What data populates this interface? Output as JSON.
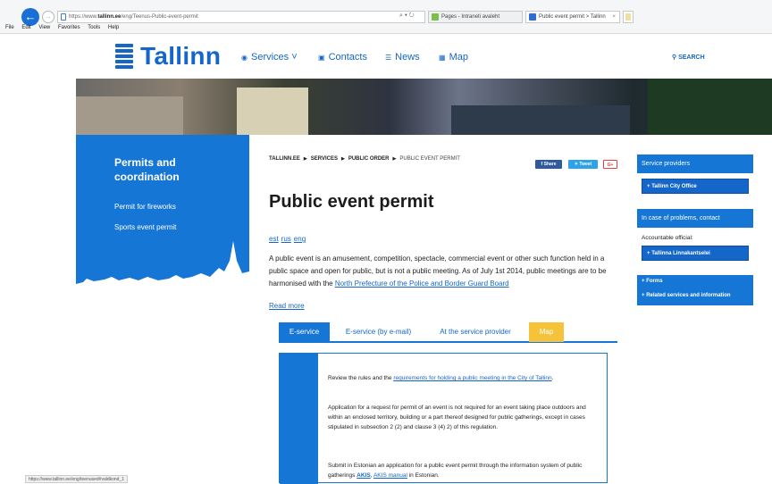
{
  "browser": {
    "url_prefix": "https://www.",
    "url_domain": "tallinn.ee",
    "url_path": "/eng/Teenus-Public-event-permit",
    "address_icons": "⌕ ▾ ↻",
    "tabs": [
      {
        "label": "Pages - Intraneti avaleht"
      },
      {
        "label": "Public event permit > Tallinn"
      }
    ],
    "tab_close": "×",
    "menu": [
      "File",
      "Edit",
      "View",
      "Favorites",
      "Tools",
      "Help"
    ],
    "status_url": "https://www.tallinn.ee/eng/teenused#valdkond_1"
  },
  "header": {
    "logo_text": "Tallinn",
    "nav": {
      "services": "Services",
      "services_caret": "˅",
      "contacts": "Contacts",
      "news": "News",
      "map": "Map"
    },
    "search_label": "SEARCH"
  },
  "leftbar": {
    "title": "Permits and coordination",
    "links": [
      "Permit for fireworks",
      "Sports event permit"
    ]
  },
  "breadcrumb": [
    "TALLINN.EE",
    "SERVICES",
    "PUBLIC ORDER",
    "PUBLIC EVENT PERMIT"
  ],
  "share": {
    "facebook": "Share",
    "twitter": "Tweet",
    "gplus": "G+"
  },
  "article": {
    "title": "Public event permit",
    "languages": [
      "est",
      "rus",
      "eng"
    ],
    "intro_text": "A public event is an amusement, competition, spectacle, commercial event or other such function held in a public space and open for public, but is not a public meeting. As of July 1st 2014, public meetings are to be harmonised with the ",
    "intro_link": "North Prefecture of the Police and Border Guard Board",
    "read_more": "Read more"
  },
  "content_tabs": [
    "E-service",
    "E-service (by e-mail)",
    "At the service provider",
    "Map"
  ],
  "content": {
    "p1_text": "Review the rules and the ",
    "p1_link": "requirements for holding a public meeting in the City of Tallinn",
    "p1_end": ".",
    "p2": "Application for a request for permit of an event is not required for an event taking place outdoors and within an enclosed territory, building or a part thereof designed for public gatherings, except in cases stipulated in subsection 2 (2) and clause 3 (4) 2) of this regulation.",
    "p3_text": "Submit in Estonian an application for a public event permit through the information system of public gatherings ",
    "p3_link1": "AKIS",
    "p3_sep": ", ",
    "p3_link2": "AKIS manual",
    "p3_end": " in Estonian."
  },
  "rightbar": {
    "providers_title": "Service providers",
    "provider_btn": "Tallinn City Office",
    "problems_title": "In case of problems, contact",
    "official_label": "Accountable official:",
    "official_btn": "Tallinna Linnakantselei",
    "forms": "Forms",
    "related": "Related services and information",
    "plus": "+"
  },
  "colors": {
    "brand_blue": "#1676d6",
    "map_tab": "#f6c23a"
  }
}
